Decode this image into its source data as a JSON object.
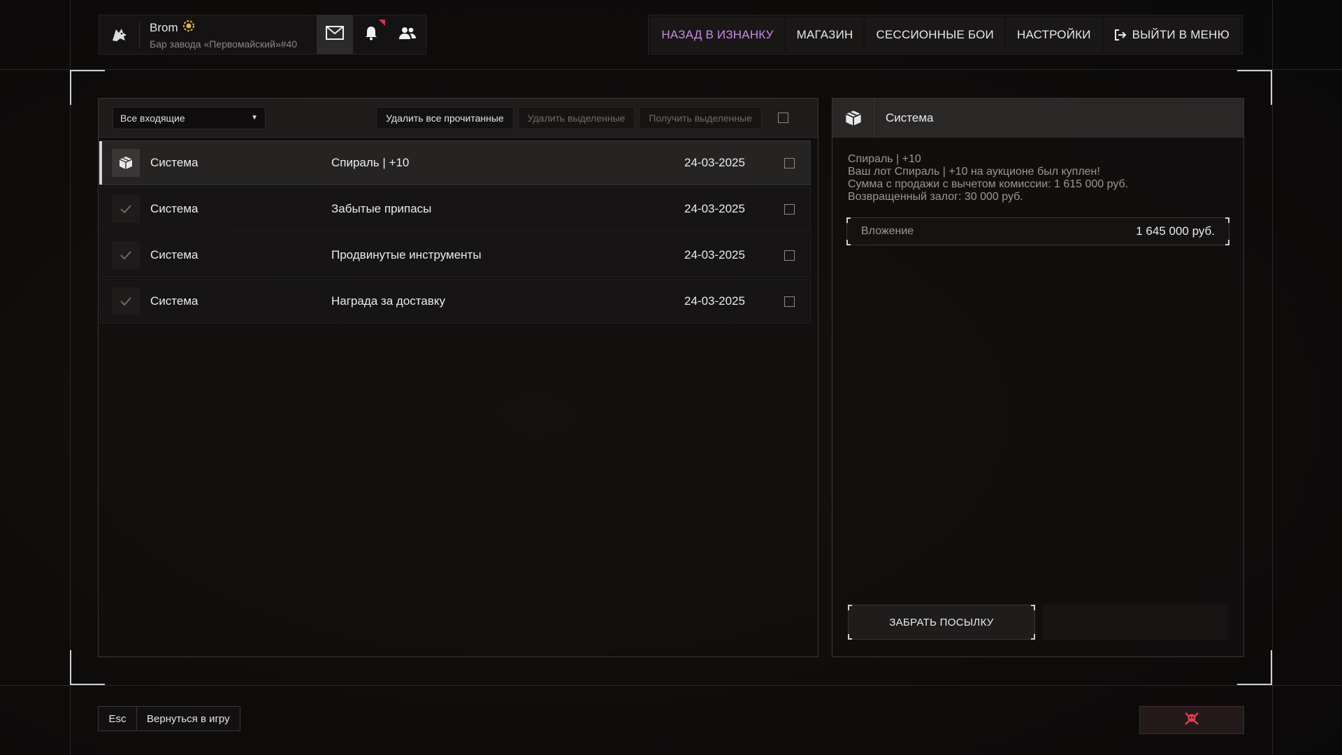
{
  "user": {
    "name": "Brom",
    "location": "Бар завода «Первомайский»#40",
    "logo_icon": "wolf-logo-icon",
    "badge_icon": "rank-badge-icon"
  },
  "header_icons": [
    "mail-icon",
    "bell-icon",
    "friends-icon"
  ],
  "nav": {
    "items": [
      {
        "label": "НАЗАД В ИЗНАНКУ",
        "accent": true
      },
      {
        "label": "МАГАЗИН"
      },
      {
        "label": "СЕССИОННЫЕ БОИ"
      },
      {
        "label": "НАСТРОЙКИ"
      },
      {
        "label": "ВЫЙТИ В МЕНЮ",
        "icon": "logout-icon"
      }
    ]
  },
  "toolbar": {
    "filter_value": "Все входящие",
    "delete_read": "Удалить все прочитанные",
    "delete_selected": "Удалить выделенные",
    "receive_selected": "Получить выделенные"
  },
  "messages": [
    {
      "sender": "Система",
      "subject": "Спираль | +10",
      "date": "24-03-2025",
      "icon": "package-icon",
      "active": true
    },
    {
      "sender": "Система",
      "subject": "Забытые припасы",
      "date": "24-03-2025",
      "icon": "check-icon"
    },
    {
      "sender": "Система",
      "subject": "Продвинутые инструменты",
      "date": "24-03-2025",
      "icon": "check-icon"
    },
    {
      "sender": "Система",
      "subject": "Награда за доставку",
      "date": "24-03-2025",
      "icon": "check-icon"
    }
  ],
  "detail": {
    "sender": "Система",
    "lines": [
      "Спираль | +10",
      "Ваш лот Спираль | +10 на аукционе был куплен!",
      "Сумма с продажи с вычетом комиссии: 1 615 000 руб.",
      "Возвращенный залог: 30 000 руб."
    ],
    "attachment_label": "Вложение",
    "attachment_value": "1 645 000 руб.",
    "claim_button": "ЗАБРАТЬ ПОСЫЛКУ"
  },
  "footer": {
    "key": "Esc",
    "action": "Вернуться в игру"
  },
  "colors": {
    "accent": "#c98be6",
    "notification": "#d9344a"
  }
}
